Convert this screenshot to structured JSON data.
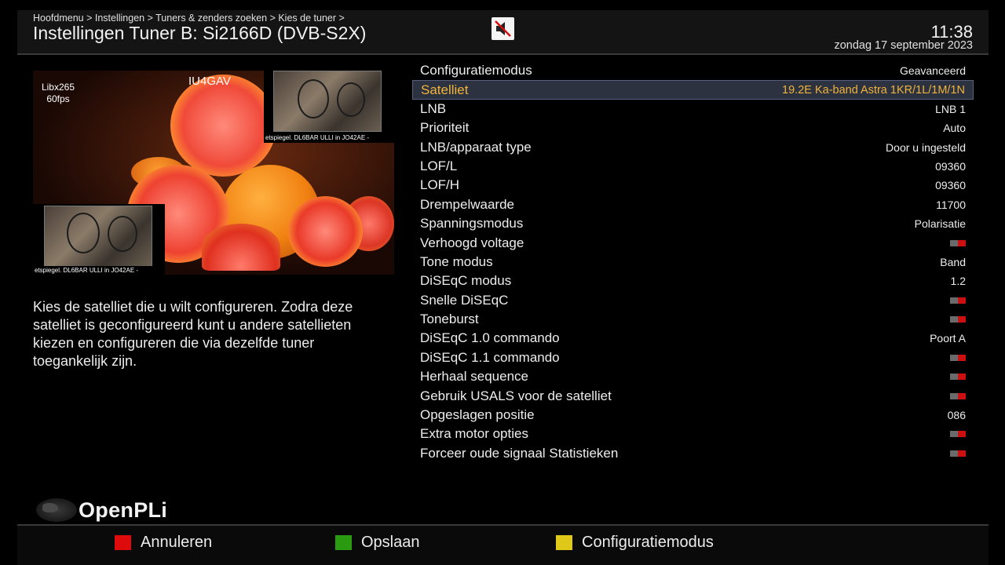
{
  "header": {
    "breadcrumb": "Hoofdmenu > Instellingen > Tuners & zenders zoeken > Kies de tuner >",
    "title": "Instellingen Tuner B: Si2166D (DVB-S2X)",
    "mute_icon": "speaker-muted-icon",
    "time": "11:38",
    "date": "zondag 17 september 2023"
  },
  "preview": {
    "codec_line1": "Libx265",
    "codec_line2": "60fps",
    "callsign": "IU4GAV",
    "caption_top": "etspiegel.  DL6BAR  ULLI    in JO42AE  -",
    "caption_bottom": "etspiegel.  DL6BAR  ULLI    in JO42AE  -"
  },
  "help_text": "Kies de satelliet die u wilt configureren. Zodra deze satelliet is geconfigureerd kunt u andere satellieten kiezen en configureren die via dezelfde tuner toegankelijk zijn.",
  "config": {
    "rows": [
      {
        "label": "Configuratiemodus",
        "value": "Geavanceerd",
        "toggle": false,
        "selected": false
      },
      {
        "label": "Satelliet",
        "value": "19.2E Ka-band Astra 1KR/1L/1M/1N",
        "toggle": false,
        "selected": true
      },
      {
        "label": "LNB",
        "value": "LNB 1",
        "toggle": false,
        "selected": false
      },
      {
        "label": "Prioriteit",
        "value": "Auto",
        "toggle": false,
        "selected": false
      },
      {
        "label": "LNB/apparaat type",
        "value": "Door u ingesteld",
        "toggle": false,
        "selected": false
      },
      {
        "label": "LOF/L",
        "value": "09360",
        "toggle": false,
        "selected": false
      },
      {
        "label": "LOF/H",
        "value": "09360",
        "toggle": false,
        "selected": false
      },
      {
        "label": "Drempelwaarde",
        "value": "11700",
        "toggle": false,
        "selected": false
      },
      {
        "label": "Spanningsmodus",
        "value": "Polarisatie",
        "toggle": false,
        "selected": false
      },
      {
        "label": "Verhoogd voltage",
        "value": "",
        "toggle": true,
        "selected": false
      },
      {
        "label": "Tone modus",
        "value": "Band",
        "toggle": false,
        "selected": false
      },
      {
        "label": "DiSEqC modus",
        "value": "1.2",
        "toggle": false,
        "selected": false
      },
      {
        "label": "Snelle DiSEqC",
        "value": "",
        "toggle": true,
        "selected": false
      },
      {
        "label": "Toneburst",
        "value": "",
        "toggle": true,
        "selected": false
      },
      {
        "label": "DiSEqC 1.0 commando",
        "value": "Poort A",
        "toggle": false,
        "selected": false
      },
      {
        "label": "DiSEqC 1.1 commando",
        "value": "",
        "toggle": true,
        "selected": false
      },
      {
        "label": "Herhaal sequence",
        "value": "",
        "toggle": true,
        "selected": false
      },
      {
        "label": "Gebruik USALS voor de satelliet",
        "value": "",
        "toggle": true,
        "selected": false
      },
      {
        "label": "Opgeslagen positie",
        "value": "086",
        "toggle": false,
        "selected": false
      },
      {
        "label": "Extra motor opties",
        "value": "",
        "toggle": true,
        "selected": false
      },
      {
        "label": "Forceer oude signaal Statistieken",
        "value": "",
        "toggle": true,
        "selected": false
      }
    ]
  },
  "logo": {
    "name": "OpenPLi",
    "icon": "globe-icon"
  },
  "footer": {
    "red_label": "Annuleren",
    "green_label": "Opslaan",
    "yellow_label": "Configuratiemodus",
    "colors": {
      "red": "#dd0b0b",
      "green": "#2a9a10",
      "yellow": "#e0c818"
    }
  },
  "colors": {
    "selected_text": "#f0b33a",
    "toggle_on": "#cc1010",
    "toggle_off": "#6a6a6a"
  }
}
